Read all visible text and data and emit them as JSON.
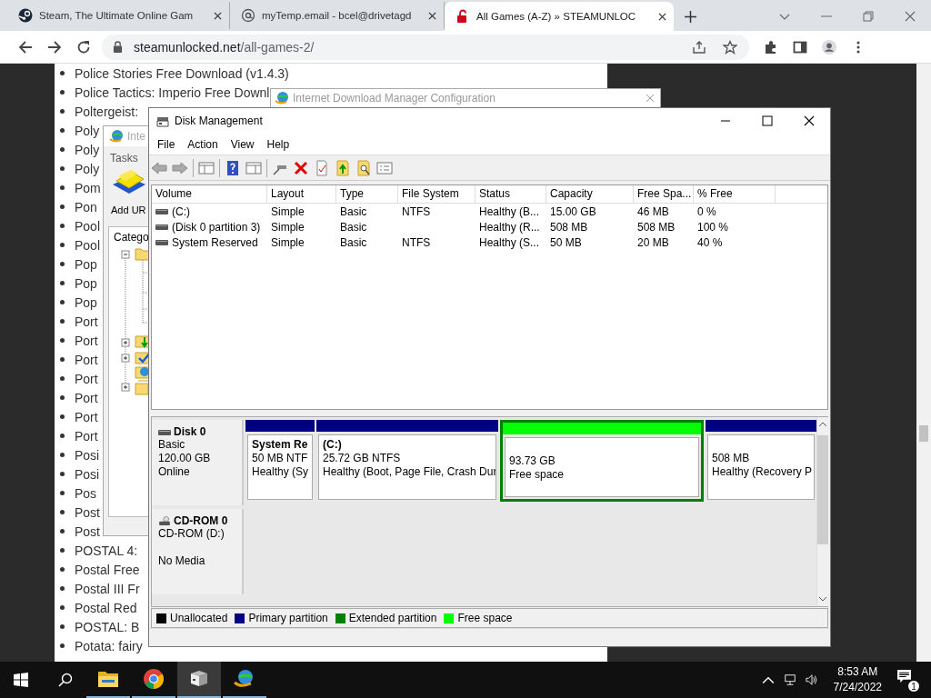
{
  "browser": {
    "tabs": [
      {
        "title": "Steam, The Ultimate Online Gam",
        "kind": "steam",
        "selected": false
      },
      {
        "title": "myTemp.email - bcel@drivetagd",
        "kind": "mail",
        "selected": false
      },
      {
        "title": "All Games (A-Z) » STEAMUNLOC",
        "kind": "lock",
        "selected": true
      }
    ],
    "url_host": "steamunlocked.net",
    "url_path": "/all-games-2/"
  },
  "page": {
    "games": [
      "Police Stories Free Download (v1.4.3)",
      "Police Tactics: Imperio Free Downl",
      "Poltergeist:",
      "Poly",
      "Poly",
      "Poly",
      "Pom",
      "Pon",
      "Pool",
      "Pool",
      "Pop",
      "Pop",
      "Pop",
      "Port",
      "Port",
      "Port",
      "Port",
      "Port",
      "Port",
      "Port",
      "Posi",
      "Posi",
      "Pos",
      "Post",
      "Post",
      "POSTAL 4:",
      "Postal Free",
      "Postal III Fr",
      "Postal Red",
      "POSTAL: B",
      "Potata: fairy"
    ]
  },
  "idm_config_window": {
    "title": "Internet Download Manager Configuration"
  },
  "idm_window": {
    "title": "Inte",
    "menu": "Tasks",
    "add_url": "Add UR",
    "category_header": "Catego"
  },
  "disk_management": {
    "title": "Disk Management",
    "menu": [
      "File",
      "Action",
      "View",
      "Help"
    ],
    "columns": [
      "Volume",
      "Layout",
      "Type",
      "File System",
      "Status",
      "Capacity",
      "Free Spa...",
      "% Free"
    ],
    "volumes": [
      {
        "cells": [
          "(C:)",
          "Simple",
          "Basic",
          "NTFS",
          "Healthy (B...",
          "15.00 GB",
          "46 MB",
          "0 %"
        ]
      },
      {
        "cells": [
          "(Disk 0 partition 3)",
          "Simple",
          "Basic",
          "",
          "Healthy (R...",
          "508 MB",
          "508 MB",
          "100 %"
        ]
      },
      {
        "cells": [
          "System Reserved",
          "Simple",
          "Basic",
          "NTFS",
          "Healthy (S...",
          "50 MB",
          "20 MB",
          "40 %"
        ]
      }
    ],
    "disks": [
      {
        "kind": "disk",
        "name": "Disk 0",
        "lines": [
          "Basic",
          "120.00 GB",
          "Online"
        ],
        "partitions": [
          {
            "kind": "primary",
            "name": "System Re",
            "lines": [
              "50 MB NTF",
              "Healthy (Sy"
            ]
          },
          {
            "kind": "primary",
            "name": "(C:)",
            "lines": [
              "25.72 GB NTFS",
              "Healthy (Boot, Page File, Crash Dur"
            ]
          },
          {
            "kind": "free",
            "lines": [
              "93.73 GB",
              "Free space"
            ]
          },
          {
            "kind": "primary",
            "lines": [
              "508 MB",
              "Healthy (Recovery P"
            ]
          }
        ]
      },
      {
        "kind": "cdrom",
        "name": "CD-ROM 0",
        "lines": [
          "CD-ROM (D:)",
          "No Media"
        ]
      }
    ],
    "legend": [
      {
        "label": "Unallocated",
        "color": "#000000"
      },
      {
        "label": "Primary partition",
        "color": "#000080"
      },
      {
        "label": "Extended partition",
        "color": "#008000"
      },
      {
        "label": "Free space",
        "color": "#00ff00"
      }
    ]
  },
  "taskbar": {
    "apps": [
      {
        "kind": "explorer",
        "selected": false
      },
      {
        "kind": "chrome",
        "selected": false
      },
      {
        "kind": "disk",
        "selected": true
      },
      {
        "kind": "idm",
        "selected": false
      }
    ],
    "time": "8:53 AM",
    "date": "7/24/2022",
    "notifications": "1"
  }
}
